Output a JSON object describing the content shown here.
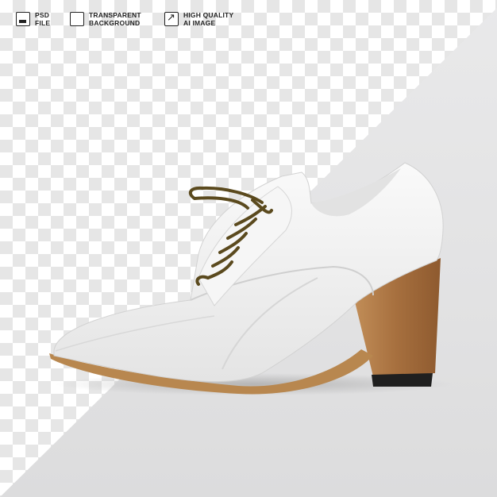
{
  "badges": [
    {
      "icon": "psd-file-icon",
      "line1": "PSD",
      "line2": "FILE"
    },
    {
      "icon": "transparent-background-icon",
      "line1": "TRANSPARENT",
      "line2": "BACKGROUND"
    },
    {
      "icon": "high-quality-icon",
      "line1": "HIGH QUALITY",
      "line2": "AI IMAGE"
    }
  ],
  "colors": {
    "shoe_leather": "#f2f2f2",
    "heel_wood": "#b07a46",
    "sole_edge": "#b8874f",
    "laces": "#5b4a1e",
    "background_gray": "#e4e4e5"
  },
  "subject": "white leather lace-up heeled shoe"
}
